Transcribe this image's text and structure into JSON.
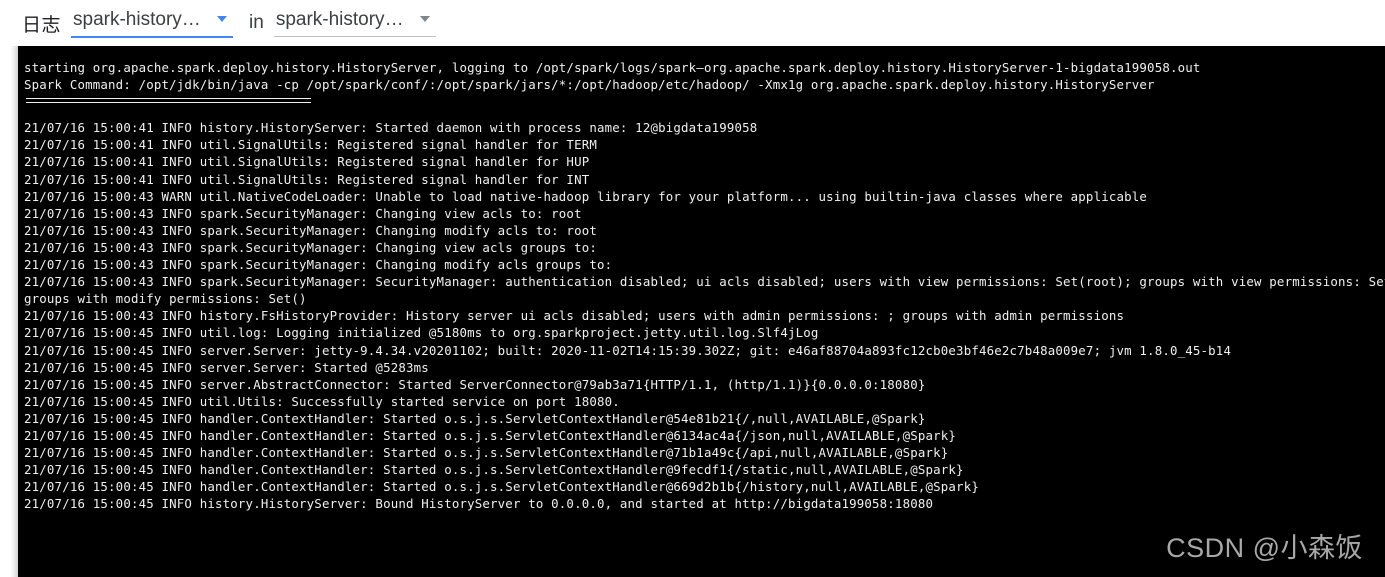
{
  "header": {
    "label": "日志",
    "primary_select": {
      "value": "spark-historyse…",
      "caret": "chevron-down-icon",
      "accent_color": "#4285f4"
    },
    "connector_word": "in",
    "secondary_select": {
      "value": "spark-historyse…",
      "caret": "chevron-down-icon",
      "accent_color": "#bdc1c6"
    }
  },
  "console": {
    "background_color": "#000000",
    "text_color": "#f0f0f0",
    "lines": [
      {
        "type": "text",
        "text": "starting org.apache.spark.deploy.history.HistoryServer, logging to /opt/spark/logs/spark—org.apache.spark.deploy.history.HistoryServer-1-bigdata199058.out"
      },
      {
        "type": "text",
        "text": "Spark Command: /opt/jdk/bin/java -cp /opt/spark/conf/:/opt/spark/jars/*:/opt/hadoop/etc/hadoop/ -Xmx1g org.apache.spark.deploy.history.HistoryServer"
      },
      {
        "type": "rule",
        "text": "========================================"
      },
      {
        "type": "spacer",
        "text": ""
      },
      {
        "type": "text",
        "text": "21/07/16 15:00:41 INFO history.HistoryServer: Started daemon with process name: 12@bigdata199058"
      },
      {
        "type": "text",
        "text": "21/07/16 15:00:41 INFO util.SignalUtils: Registered signal handler for TERM"
      },
      {
        "type": "text",
        "text": "21/07/16 15:00:41 INFO util.SignalUtils: Registered signal handler for HUP"
      },
      {
        "type": "text",
        "text": "21/07/16 15:00:41 INFO util.SignalUtils: Registered signal handler for INT"
      },
      {
        "type": "text",
        "text": "21/07/16 15:00:43 WARN util.NativeCodeLoader: Unable to load native-hadoop library for your platform... using builtin-java classes where applicable"
      },
      {
        "type": "text",
        "text": "21/07/16 15:00:43 INFO spark.SecurityManager: Changing view acls to: root"
      },
      {
        "type": "text",
        "text": "21/07/16 15:00:43 INFO spark.SecurityManager: Changing modify acls to: root"
      },
      {
        "type": "text",
        "text": "21/07/16 15:00:43 INFO spark.SecurityManager: Changing view acls groups to:"
      },
      {
        "type": "text",
        "text": "21/07/16 15:00:43 INFO spark.SecurityManager: Changing modify acls groups to:"
      },
      {
        "type": "text",
        "text": "21/07/16 15:00:43 INFO spark.SecurityManager: SecurityManager: authentication disabled; ui acls disabled; users with view permissions: Set(root); groups with view permissions: Set(); users with m"
      },
      {
        "type": "text",
        "text": "groups with modify permissions: Set()"
      },
      {
        "type": "text",
        "text": "21/07/16 15:00:43 INFO history.FsHistoryProvider: History server ui acls disabled; users with admin permissions: ; groups with admin permissions"
      },
      {
        "type": "text",
        "text": "21/07/16 15:00:45 INFO util.log: Logging initialized @5180ms to org.sparkproject.jetty.util.log.Slf4jLog"
      },
      {
        "type": "text",
        "text": "21/07/16 15:00:45 INFO server.Server: jetty-9.4.34.v20201102; built: 2020-11-02T14:15:39.302Z; git: e46af88704a893fc12cb0e3bf46e2c7b48a009e7; jvm 1.8.0_45-b14"
      },
      {
        "type": "text",
        "text": "21/07/16 15:00:45 INFO server.Server: Started @5283ms"
      },
      {
        "type": "text",
        "text": "21/07/16 15:00:45 INFO server.AbstractConnector: Started ServerConnector@79ab3a71{HTTP/1.1, (http/1.1)}{0.0.0.0:18080}"
      },
      {
        "type": "text",
        "text": "21/07/16 15:00:45 INFO util.Utils: Successfully started service on port 18080."
      },
      {
        "type": "text",
        "text": "21/07/16 15:00:45 INFO handler.ContextHandler: Started o.s.j.s.ServletContextHandler@54e81b21{/,null,AVAILABLE,@Spark}"
      },
      {
        "type": "text",
        "text": "21/07/16 15:00:45 INFO handler.ContextHandler: Started o.s.j.s.ServletContextHandler@6134ac4a{/json,null,AVAILABLE,@Spark}"
      },
      {
        "type": "text",
        "text": "21/07/16 15:00:45 INFO handler.ContextHandler: Started o.s.j.s.ServletContextHandler@71b1a49c{/api,null,AVAILABLE,@Spark}"
      },
      {
        "type": "text",
        "text": "21/07/16 15:00:45 INFO handler.ContextHandler: Started o.s.j.s.ServletContextHandler@9fecdf1{/static,null,AVAILABLE,@Spark}"
      },
      {
        "type": "text",
        "text": "21/07/16 15:00:45 INFO handler.ContextHandler: Started o.s.j.s.ServletContextHandler@669d2b1b{/history,null,AVAILABLE,@Spark}"
      },
      {
        "type": "text",
        "text": "21/07/16 15:00:45 INFO history.HistoryServer: Bound HistoryServer to 0.0.0.0, and started at http://bigdata199058:18080"
      }
    ]
  },
  "watermark": {
    "text": "CSDN @小森饭"
  }
}
